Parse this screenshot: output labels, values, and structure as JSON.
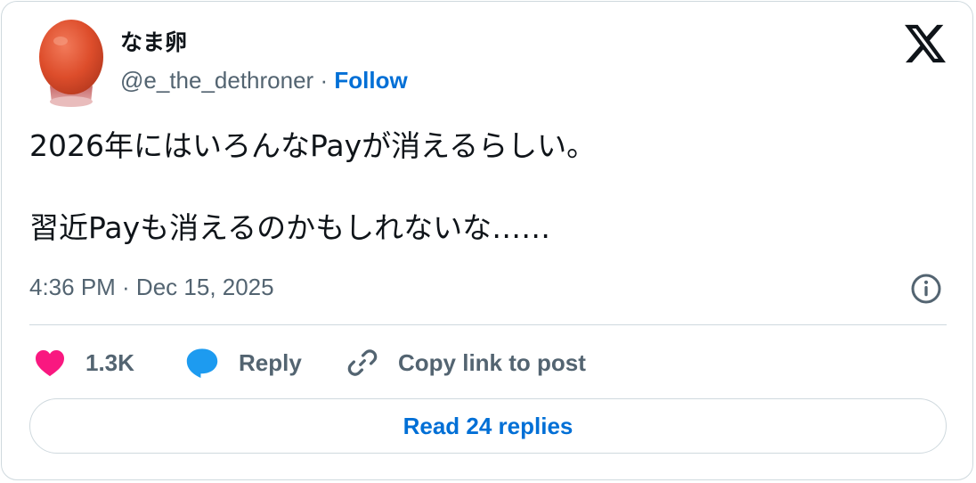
{
  "author": {
    "display_name": "なま卵",
    "handle": "@e_the_dethroner",
    "separator": "·",
    "follow_label": "Follow",
    "avatar_icon": "egg-avatar"
  },
  "platform": {
    "logo_icon": "x-logo-icon"
  },
  "tweet": {
    "lines": [
      "2026年にはいろんなPayが消えるらしい。",
      "習近Payも消えるのかもしれないな……"
    ]
  },
  "meta": {
    "timestamp": "4:36 PM · Dec 15, 2025",
    "info_icon": "info-icon"
  },
  "actions": {
    "like_count": "1.3K",
    "like_icon": "heart-icon",
    "reply_label": "Reply",
    "reply_icon": "speech-bubble-icon",
    "copy_label": "Copy link to post",
    "copy_icon": "link-icon"
  },
  "read_replies_label": "Read 24 replies",
  "colors": {
    "text_primary": "#0f1419",
    "text_secondary": "#536471",
    "link_blue": "#006fd6",
    "like_pink": "#f91880",
    "reply_blue": "#1d9bf0",
    "border": "#cfd9de"
  }
}
